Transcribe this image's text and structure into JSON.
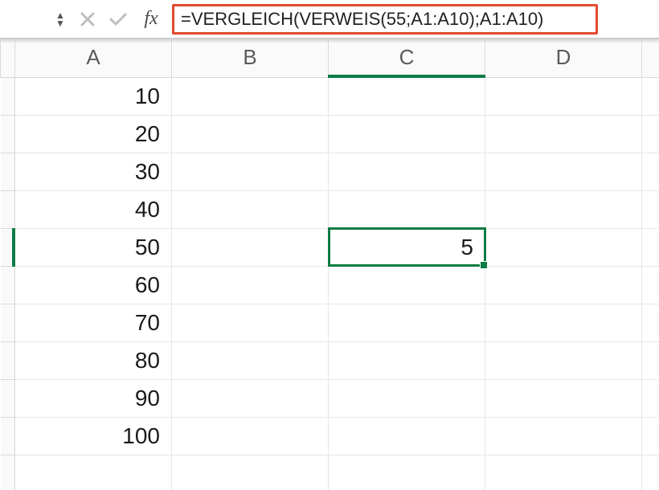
{
  "formula_bar": {
    "fx_label": "fx",
    "formula": "=VERGLEICH(VERWEIS(55;A1:A10);A1:A10)"
  },
  "columns": [
    "A",
    "B",
    "C",
    "D"
  ],
  "active_column_index": 2,
  "active_row_index": 4,
  "selected_cell_value": "5",
  "rows": [
    {
      "A": "10"
    },
    {
      "A": "20"
    },
    {
      "A": "30"
    },
    {
      "A": "40"
    },
    {
      "A": "50",
      "C": "5"
    },
    {
      "A": "60"
    },
    {
      "A": "70"
    },
    {
      "A": "80"
    },
    {
      "A": "90"
    },
    {
      "A": "100"
    },
    {
      "A": ""
    }
  ],
  "colors": {
    "selection": "#0f7b45",
    "highlight_border": "#e34a2f"
  }
}
